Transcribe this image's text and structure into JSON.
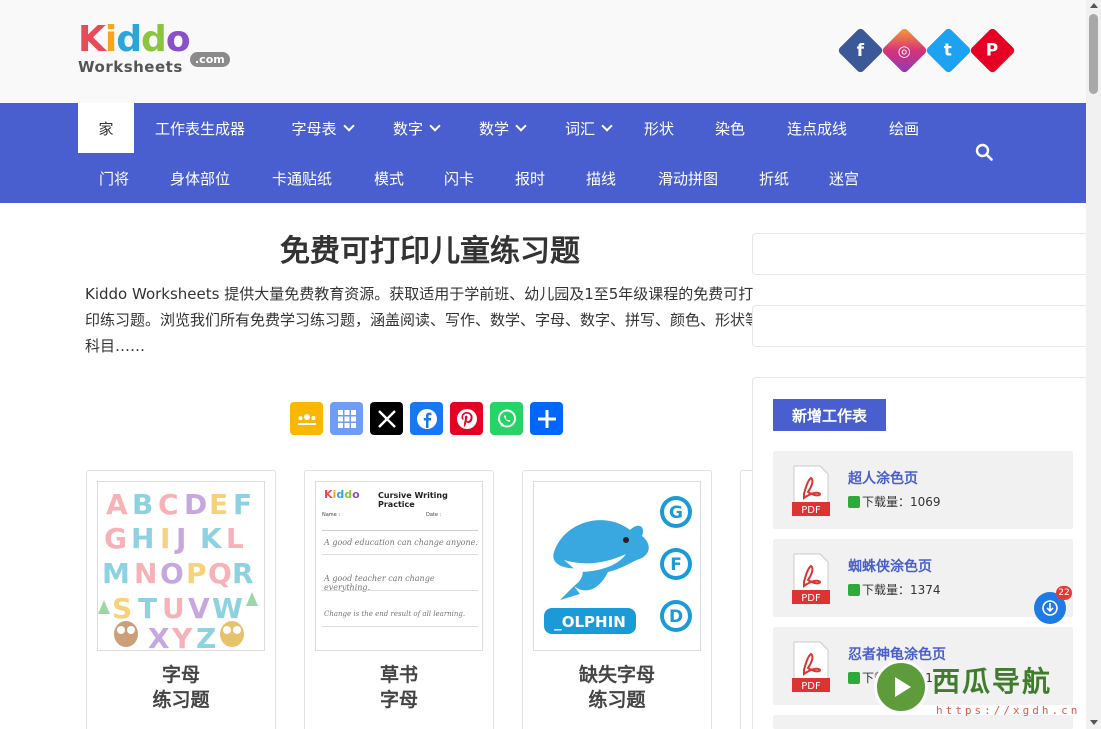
{
  "logo": {
    "top": "Kiddo",
    "bottom": "Worksheets",
    "suffix": ".com"
  },
  "social": [
    {
      "name": "facebook",
      "glyph": "f",
      "color": "#3b5998"
    },
    {
      "name": "instagram",
      "glyph": "◎",
      "color": "#d6337a"
    },
    {
      "name": "twitter",
      "glyph": "t",
      "color": "#1da1f2"
    },
    {
      "name": "pinterest",
      "glyph": "P",
      "color": "#e60023"
    }
  ],
  "nav": {
    "row1": [
      "家",
      "工作表生成器",
      "字母表",
      "数字",
      "数学",
      "词汇",
      "形状",
      "染色",
      "连点成线",
      "绘画"
    ],
    "row2": [
      "门将",
      "身体部位",
      "卡通贴纸",
      "模式",
      "闪卡",
      "报时",
      "描线",
      "滑动拼图",
      "折纸",
      "迷宫"
    ]
  },
  "main": {
    "title": "免费可打印儿童练习题",
    "intro": "Kiddo Worksheets 提供大量免费教育资源。获取适用于学前班、幼儿园及1至5年级课程的免费可打印练习题。浏览我们所有免费学习练习题，涵盖阅读、写作、数学、字母、数字、拼写、颜色、形状等科目……"
  },
  "share": [
    {
      "name": "google-classroom",
      "color": "#f9b700"
    },
    {
      "name": "microsoft-teams",
      "color": "#5b8cf0"
    },
    {
      "name": "x",
      "color": "#000000"
    },
    {
      "name": "facebook",
      "color": "#1877f2"
    },
    {
      "name": "pinterest",
      "color": "#e60023"
    },
    {
      "name": "whatsapp",
      "color": "#25d366"
    },
    {
      "name": "share",
      "color": "#0166ff"
    }
  ],
  "cards": [
    {
      "line1": "字母",
      "line2": "练习题",
      "thumb": "ABCDEF GHIJKL MNOPQR STUVW XYZ"
    },
    {
      "line1": "草书",
      "line2": "字母",
      "thumb": "Cursive Writing Practice",
      "lines": [
        "A good education can change anyone.",
        "A good teacher can change everything.",
        "Change is the end result of all learning."
      ],
      "name_label": "Name :",
      "date_label": "Date :"
    },
    {
      "line1": "缺失字母",
      "line2": "练习题",
      "thumb": "_OLPHIN",
      "letters": [
        "G",
        "F",
        "D"
      ]
    }
  ],
  "sidebar": {
    "title": "新增工作表",
    "items": [
      {
        "name": "超人涂色页",
        "downloads": "下载量：1069"
      },
      {
        "name": "蜘蛛侠涂色页",
        "downloads": "下载量：1374"
      },
      {
        "name": "忍者神龟涂色页",
        "downloads": "下载量：641"
      }
    ],
    "pdf_label": "PDF"
  },
  "floating": {
    "badge": "22"
  },
  "watermark": {
    "text": "西瓜导航",
    "url": "https://xgdh.cn"
  },
  "colors": {
    "nav": "#4a5fcf",
    "accent": "#4a5fcf"
  }
}
